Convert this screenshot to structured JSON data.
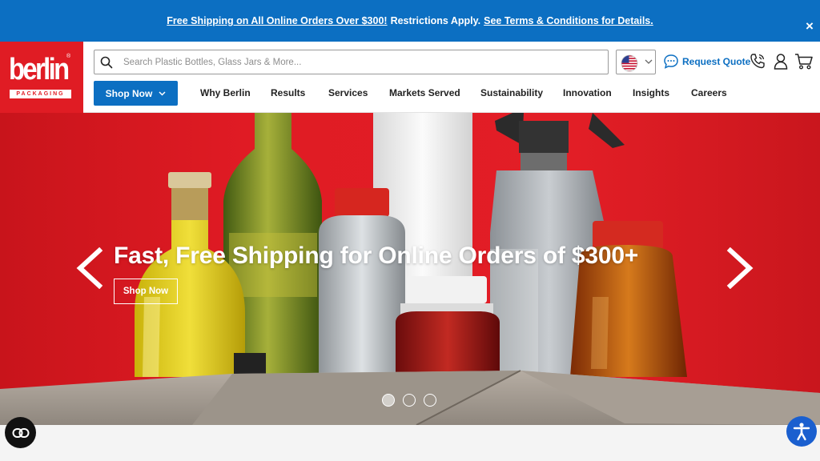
{
  "promo": {
    "link1": "Free Shipping on All Online Orders Over $300!",
    "middle": "Restrictions Apply.",
    "link2": "See Terms & Conditions for Details.",
    "close": "×"
  },
  "logo": {
    "word": "berlin",
    "reg": "®",
    "sub": "PACKAGING"
  },
  "search": {
    "placeholder": "Search Plastic Bottles, Glass Jars & More..."
  },
  "header": {
    "request_quote": "Request Quote",
    "country_flag": "us-flag-icon"
  },
  "nav": {
    "shop_now": "Shop Now",
    "items": [
      "Why Berlin",
      "Results",
      "Services",
      "Markets Served",
      "Sustainability",
      "Innovation",
      "Insights",
      "Careers"
    ]
  },
  "hero": {
    "title": "Fast, Free Shipping for Online Orders of $300+",
    "button": "Shop Now",
    "slides": 3,
    "active_slide": 1
  },
  "colors": {
    "brand_red": "#e01c24",
    "accent_blue": "#0c6fc2"
  }
}
